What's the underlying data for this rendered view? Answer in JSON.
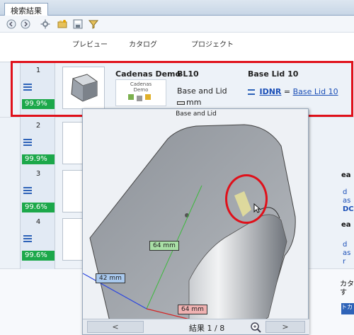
{
  "tab": {
    "label": "検索結果"
  },
  "columns": {
    "preview": "プレビュー",
    "catalog": "カタログ",
    "project": "プロジェクト"
  },
  "results": [
    {
      "rank": "1",
      "score": "99.9%"
    },
    {
      "rank": "2",
      "score": "99.9%"
    },
    {
      "rank": "3",
      "score": "99.6%"
    },
    {
      "rank": "4",
      "score": "99.6%"
    }
  ],
  "selected": {
    "catalog": "Cadenas Demo",
    "catalog_logo_text": "Cadenas\nDemo",
    "project": "BL10",
    "description": "Base and Lid",
    "unit": "mm",
    "part_name": "Base Lid 10",
    "idnr_label": "IDNR",
    "equals": "=",
    "idnr_value": "Base Lid 10"
  },
  "preview": {
    "title": "Base and Lid",
    "dimensions": {
      "green": "64 mm",
      "blue": "42 mm",
      "red": "64 mm"
    },
    "nav_prev": "<",
    "nav_next": ">",
    "nav_label": "結果 1 / 8"
  },
  "side_fragments": [
    "ea",
    "d",
    "as",
    "DC",
    "ea",
    "d",
    "as",
    "r",
    "カタ",
    "す",
    "トカ"
  ]
}
